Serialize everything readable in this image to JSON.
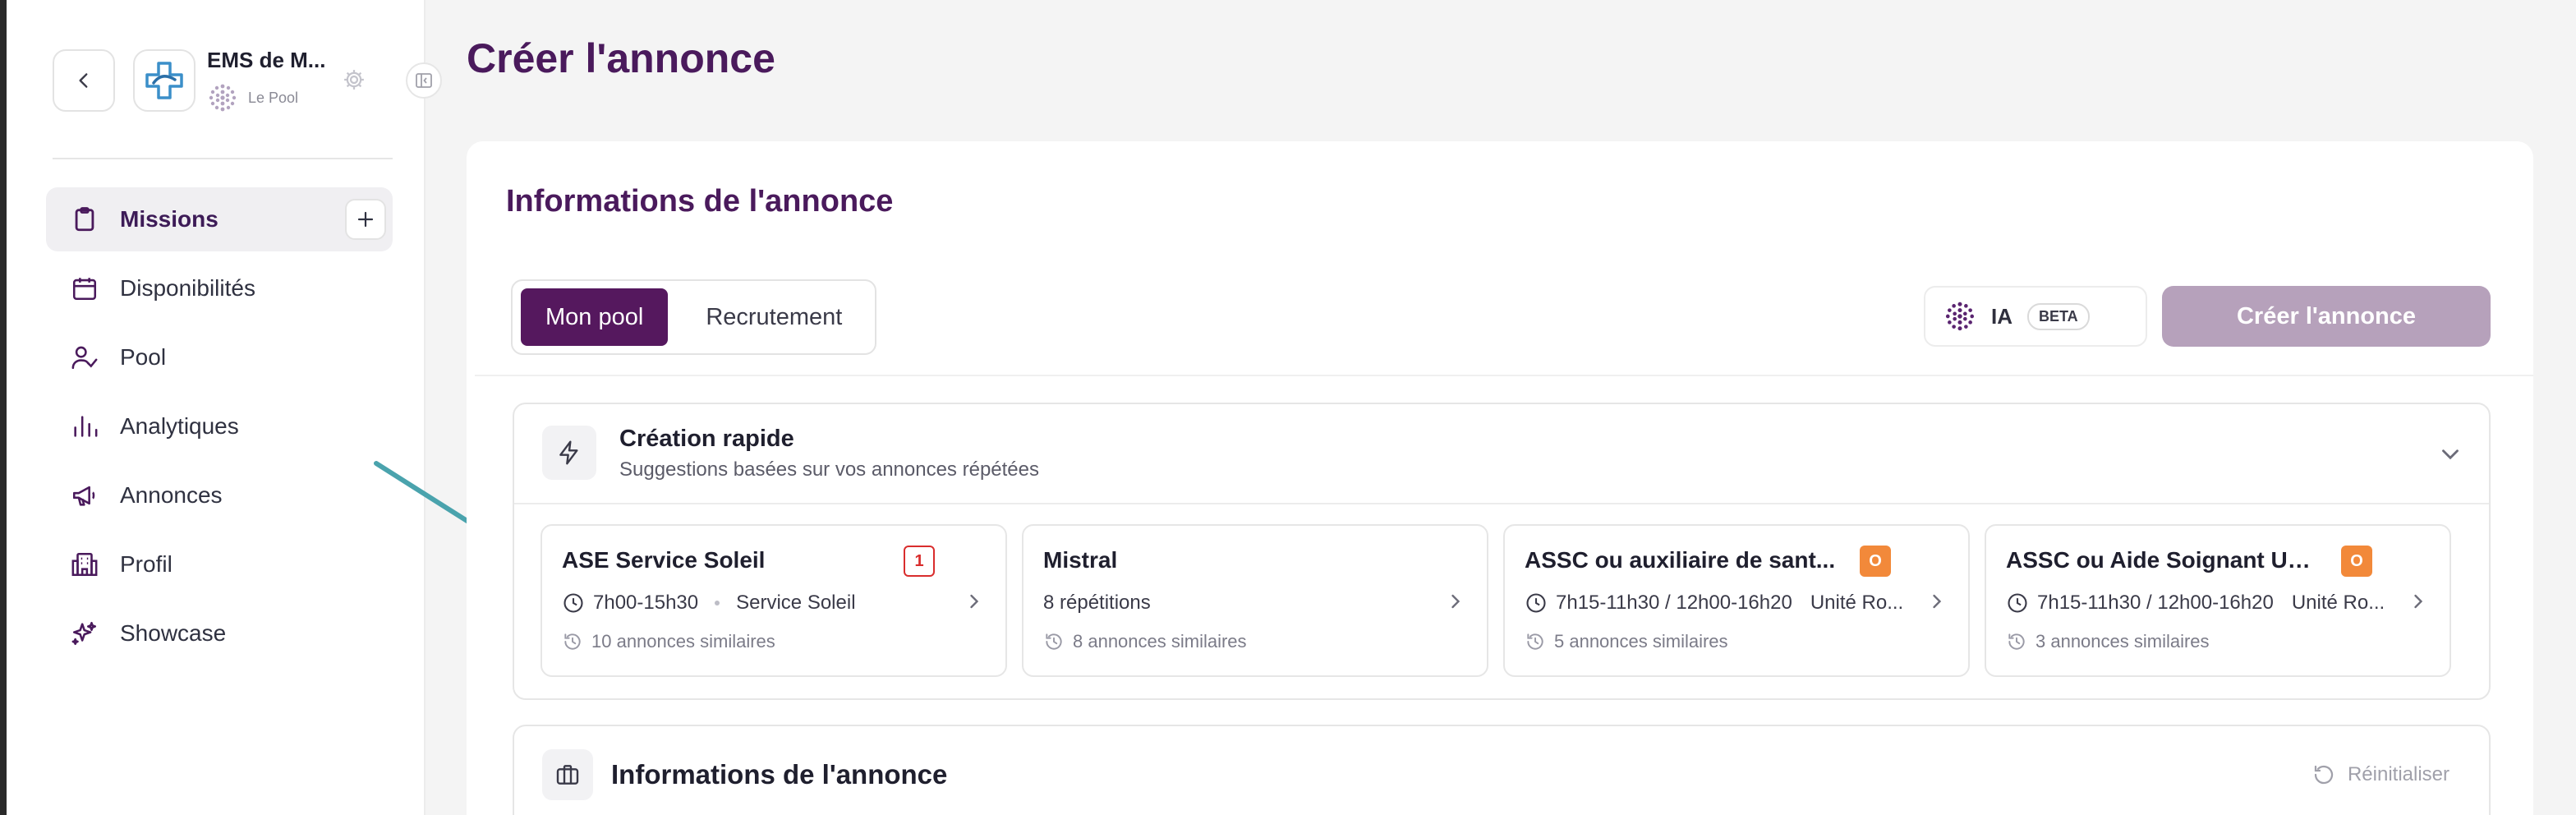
{
  "sidebar": {
    "org_name": "EMS de M...",
    "org_sub": "Le Pool",
    "items": [
      {
        "label": "Missions",
        "icon": "clipboard-icon",
        "active": true
      },
      {
        "label": "Disponibilités",
        "icon": "calendar-icon"
      },
      {
        "label": "Pool",
        "icon": "user-check-icon"
      },
      {
        "label": "Analytiques",
        "icon": "bar-chart-icon"
      },
      {
        "label": "Annonces",
        "icon": "megaphone-icon"
      },
      {
        "label": "Profil",
        "icon": "building-icon"
      },
      {
        "label": "Showcase",
        "icon": "sparkles-icon"
      }
    ]
  },
  "page": {
    "title": "Créer l'annonce"
  },
  "card": {
    "title": "Informations de l'annonce",
    "tabs": [
      "Mon pool",
      "Recrutement"
    ],
    "ia_label": "IA",
    "beta_label": "BETA",
    "create_label": "Créer l'annonce"
  },
  "quick": {
    "title": "Création rapide",
    "subtitle": "Suggestions basées sur vos annonces répétées",
    "suggestions": [
      {
        "title": "ASE Service Soleil",
        "badge": "1",
        "badge_style": "red",
        "time": "7h00-15h30",
        "location": "Service Soleil",
        "similar": "10 annonces similaires"
      },
      {
        "title": "Mistral",
        "badge": "",
        "repetitions": "8 répétitions",
        "similar": "8 annonces similaires"
      },
      {
        "title": "ASSC ou auxiliaire de sant...",
        "badge": "O",
        "badge_style": "orange",
        "time": "7h15-11h30 / 12h00-16h20",
        "location": "Unité Ro...",
        "similar": "5 annonces similaires"
      },
      {
        "title": "ASSC ou Aide Soignant Uni...",
        "badge": "O",
        "badge_style": "orange",
        "time": "7h15-11h30 / 12h00-16h20",
        "location": "Unité Ro...",
        "similar": "3 annonces similaires"
      }
    ]
  },
  "info2": {
    "title": "Informations de l'annonce",
    "reset_label": "Réinitialiser"
  },
  "colors": {
    "brand": "#4a1a5c",
    "primary_button": "#55185e",
    "disabled_button": "#b6a1bb",
    "badge_red": "#d92d2d",
    "badge_orange": "#f2893a",
    "annotation_arrow": "#4aa3ad"
  }
}
